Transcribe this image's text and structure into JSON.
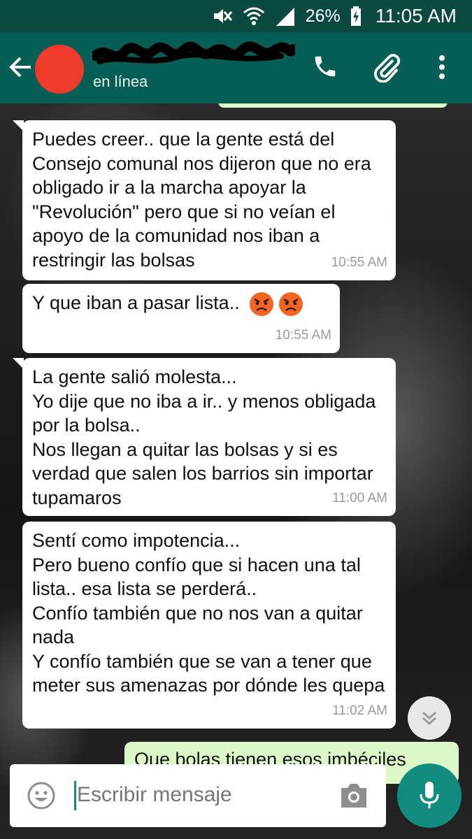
{
  "status_bar": {
    "battery": "26%",
    "time": "11:05 AM"
  },
  "header": {
    "contact_status": "en línea"
  },
  "messages": [
    {
      "direction": "incoming",
      "text": "Puedes creer.. que la gente está del Consejo comunal nos dijeron que no era obligado ir a la marcha apoyar la \"Revolución\" pero que si no veían el apoyo de la comunidad nos iban a restringir las bolsas",
      "time": "10:55 AM"
    },
    {
      "direction": "incoming",
      "text": "Y que iban a pasar lista..",
      "emoji": [
        "angry-face-icon",
        "angry-face-icon"
      ],
      "time": "10:55 AM"
    },
    {
      "direction": "incoming",
      "text": "La gente salió molesta...\nYo dije que no iba a ir.. y menos obligada por la bolsa..\nNos llegan a quitar las bolsas y si es verdad que salen los barrios sin importar tupamaros",
      "time": "11:00 AM"
    },
    {
      "direction": "incoming",
      "text": "Sentí como impotencia...\nPero bueno confío que si hacen una tal lista.. esa lista se perderá..\nConfío también que no nos van a quitar nada\nY confío también que se van a tener que meter sus amenazas por dónde les quepa",
      "time": "11:02 AM"
    },
    {
      "direction": "outgoing",
      "text": "Que bolas tienen esos imbéciles"
    }
  ],
  "composer": {
    "placeholder": "Escribir mensaje"
  },
  "colors": {
    "status_bar": "#0a4a41",
    "app_bar": "#075e54",
    "accent": "#128c7e",
    "outgoing_bubble": "#dcf8c6",
    "incoming_bubble": "#ffffff"
  }
}
